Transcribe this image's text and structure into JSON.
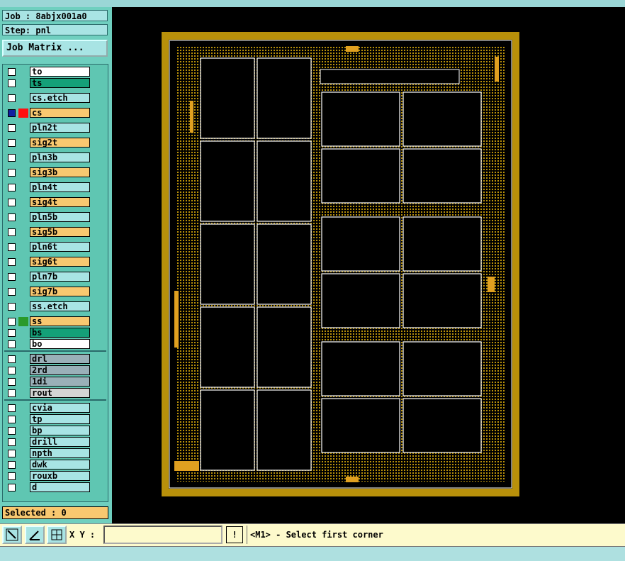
{
  "header": {
    "job": "Job : 8abjx001a0",
    "step": "Step: pnl"
  },
  "job_matrix_label": "Job Matrix ...",
  "layers": [
    {
      "name": "to",
      "bg": "#ffffff",
      "swatch": ""
    },
    {
      "name": "ts",
      "bg": "#14a078",
      "swatch": ""
    },
    {
      "name": "cs.etch",
      "bg": "#a8e4e4",
      "swatch": ""
    },
    {
      "name": "cs",
      "bg": "#f8c870",
      "swatch": "#ff1010",
      "active": true
    },
    {
      "name": "pln2t",
      "bg": "#a8e4e4",
      "swatch": ""
    },
    {
      "name": "sig2t",
      "bg": "#f8c870",
      "swatch": ""
    },
    {
      "name": "pln3b",
      "bg": "#a8e4e4",
      "swatch": ""
    },
    {
      "name": "sig3b",
      "bg": "#f8c870",
      "swatch": ""
    },
    {
      "name": "pln4t",
      "bg": "#a8e4e4",
      "swatch": ""
    },
    {
      "name": "sig4t",
      "bg": "#f8c870",
      "swatch": ""
    },
    {
      "name": "pln5b",
      "bg": "#a8e4e4",
      "swatch": ""
    },
    {
      "name": "sig5b",
      "bg": "#f8c870",
      "swatch": ""
    },
    {
      "name": "pln6t",
      "bg": "#a8e4e4",
      "swatch": ""
    },
    {
      "name": "sig6t",
      "bg": "#f8c870",
      "swatch": ""
    },
    {
      "name": "pln7b",
      "bg": "#a8e4e4",
      "swatch": ""
    },
    {
      "name": "sig7b",
      "bg": "#f8c870",
      "swatch": ""
    },
    {
      "name": "ss.etch",
      "bg": "#a8e4e4",
      "swatch": ""
    },
    {
      "name": "ss",
      "bg": "#f8c870",
      "swatch": "#2a9a2a"
    },
    {
      "name": "bs",
      "bg": "#14a078",
      "swatch": ""
    },
    {
      "name": "bo",
      "bg": "#ffffff",
      "swatch": ""
    },
    {
      "name": "drl",
      "bg": "#9ab0b8",
      "swatch": ""
    },
    {
      "name": "2rd",
      "bg": "#9ab0b8",
      "swatch": ""
    },
    {
      "name": "1di",
      "bg": "#9ab0b8",
      "swatch": ""
    },
    {
      "name": "rout",
      "bg": "#d4d4d4",
      "swatch": ""
    },
    {
      "name": "cvia",
      "bg": "#a8e4e4",
      "swatch": ""
    },
    {
      "name": "tp",
      "bg": "#a8e4e4",
      "swatch": ""
    },
    {
      "name": "bp",
      "bg": "#a8e4e4",
      "swatch": ""
    },
    {
      "name": "drill",
      "bg": "#a8e4e4",
      "swatch": ""
    },
    {
      "name": "npth",
      "bg": "#a8e4e4",
      "swatch": ""
    },
    {
      "name": "dwk",
      "bg": "#a8e4e4",
      "swatch": ""
    },
    {
      "name": "rouxb",
      "bg": "#a8e4e4",
      "swatch": ""
    },
    {
      "name": "d",
      "bg": "#a8e4e4",
      "swatch": ""
    }
  ],
  "selected": "Selected : 0",
  "toolbar": {
    "icons": [
      "zoom-fit-icon",
      "measure-icon",
      "snap-grid-icon"
    ],
    "xy_label": "X Y :",
    "xy_value": "",
    "bang_label": "!",
    "message": "<M1> - Select first corner"
  },
  "colors": {
    "board_border": "#b8900a",
    "accent": "#f8c870",
    "panel": "#6fcfbf"
  }
}
